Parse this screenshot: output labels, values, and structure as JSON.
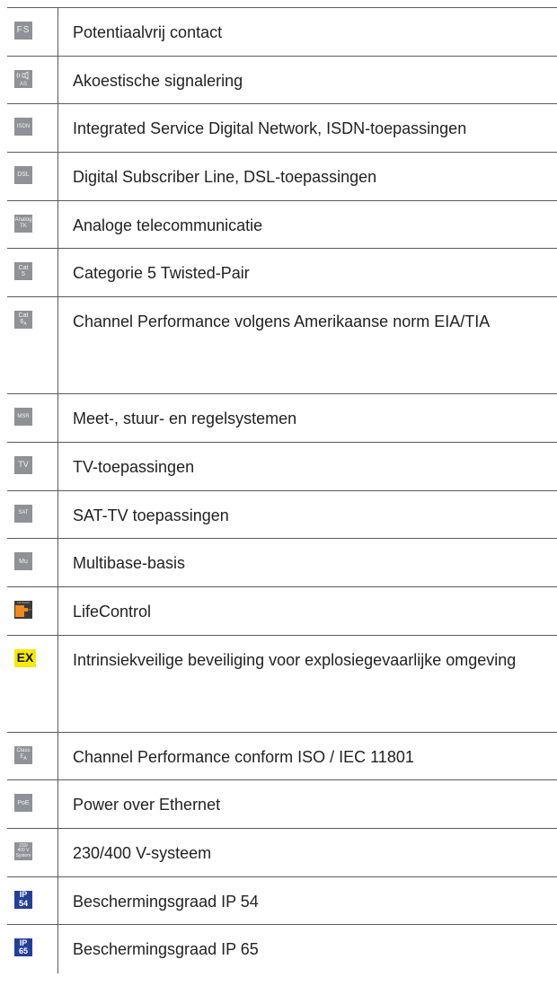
{
  "rows": [
    {
      "icon": "FS",
      "text": "Potentiaalvrij contact"
    },
    {
      "icon": "AS",
      "text": "Akoestische signalering"
    },
    {
      "icon": "ISDN",
      "text": "Integrated Service Digital Network, ISDN-toepassingen"
    },
    {
      "icon": "DSL",
      "text": "Digital Subscriber Line, DSL-toepassingen"
    },
    {
      "icon_line1": "Analog",
      "icon_line2": "TK",
      "text": "Analoge telecommunicatie"
    },
    {
      "icon_line1": "Cat",
      "icon_line2": "5",
      "text": "Categorie 5 Twisted-Pair"
    },
    {
      "icon_line1": "Cat",
      "icon_line2": "6",
      "icon_sub": "A",
      "text": "Channel Performance volgens Amerikaanse norm EIA/TIA"
    },
    {
      "icon": "MSR",
      "text": "Meet-, stuur- en regelsystemen"
    },
    {
      "icon": "TV",
      "text": "TV-toepassingen"
    },
    {
      "icon": "SAT",
      "text": "SAT-TV toepassingen"
    },
    {
      "icon": "Mu",
      "text": "Multibase-basis"
    },
    {
      "icon": "Life Control",
      "text": "LifeControl"
    },
    {
      "icon": "EX",
      "text": "Intrinsiekveilige beveiliging voor explosiegevaarlijke omgeving"
    },
    {
      "icon_line1": "Class",
      "icon_line2": "E",
      "icon_sub": "A",
      "text": "Channel Performance conform ISO / IEC 11801"
    },
    {
      "icon": "PoE",
      "text": "Power over Ethernet"
    },
    {
      "icon_line1": "230/",
      "icon_line2": "400 V",
      "icon_line3": "System",
      "text": "230/400 V-systeem"
    },
    {
      "icon_line1": "IP",
      "icon_line2": "54",
      "text": "Beschermingsgraad IP 54"
    },
    {
      "icon_line1": "IP",
      "icon_line2": "65",
      "text": "Beschermingsgraad IP 65"
    }
  ],
  "colors": {
    "badge_grey": "#8e9196",
    "badge_blue": "#243f99",
    "badge_yellow": "#f5ea00",
    "life_orange": "#f08a1c"
  }
}
